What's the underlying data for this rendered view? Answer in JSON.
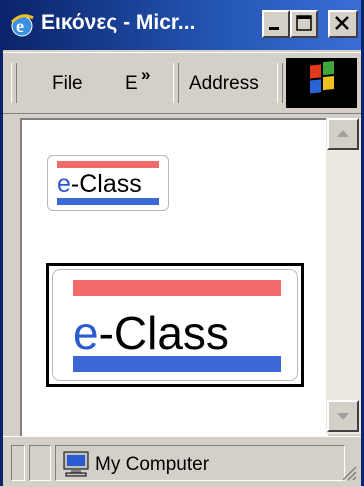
{
  "window": {
    "title": "Εικόνες - Micr...",
    "buttons": {
      "minimize": "minimize-icon",
      "maximize": "maximize-icon",
      "close": "close-icon"
    }
  },
  "toolbar": {
    "file_label": "File",
    "edit_label": "E",
    "chevron": "»",
    "address_label": "Address"
  },
  "content": {
    "logo_small": {
      "prefix": "e",
      "text": "-Class"
    },
    "logo_large": {
      "prefix": "e",
      "text": "-Class"
    }
  },
  "statusbar": {
    "zone_text": "My Computer",
    "zone_icon": "computer-icon"
  },
  "colors": {
    "titlebar": "#0a246a",
    "logo_red": "#f26b6b",
    "logo_blue": "#3a68d4"
  }
}
